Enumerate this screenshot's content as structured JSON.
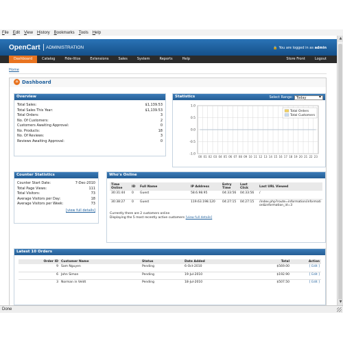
{
  "browser": {
    "menu": [
      "File",
      "Edit",
      "View",
      "History",
      "Bookmarks",
      "Tools",
      "Help"
    ],
    "status": "Done"
  },
  "header": {
    "logo": "OpenCart",
    "admin": "ADMINISTRATION",
    "logged_in_prefix": "You are logged in as",
    "user": "admin"
  },
  "nav": {
    "left": [
      "Dashboard",
      "Catalog",
      "Fide-Ittos",
      "Extensions",
      "Sales",
      "System",
      "Reports",
      "Help"
    ],
    "right": [
      "Store Front",
      "Logout"
    ]
  },
  "breadcrumb": "Home",
  "page_title": "Dashboard",
  "overview": {
    "title": "Overview",
    "rows": [
      {
        "label": "Total Sales:",
        "value": "$1,139.53"
      },
      {
        "label": "Total Sales This Year:",
        "value": "$1,139.53"
      },
      {
        "label": "Total Orders:",
        "value": "3"
      },
      {
        "label": "No. Of Customers:",
        "value": "2"
      },
      {
        "label": "Customers Awaiting Approval:",
        "value": "0"
      },
      {
        "label": "No. Products:",
        "value": "18"
      },
      {
        "label": "No. Of Reviews:",
        "value": "3"
      },
      {
        "label": "Reviews Awaiting Approval:",
        "value": "0"
      }
    ]
  },
  "statistics": {
    "title": "Statistics",
    "select_label": "Select Range:",
    "select_value": "Today"
  },
  "chart_data": {
    "type": "line",
    "x": [
      "00",
      "01",
      "02",
      "03",
      "04",
      "05",
      "06",
      "07",
      "08",
      "09",
      "10",
      "11",
      "12",
      "13",
      "14",
      "15",
      "16",
      "17",
      "18",
      "19",
      "20",
      "21",
      "22",
      "23"
    ],
    "series": [
      {
        "name": "Total Orders",
        "values": [
          0,
          0,
          0,
          0,
          0,
          0,
          0,
          0,
          0,
          0,
          0,
          0,
          0,
          0,
          0,
          0,
          0,
          0,
          0,
          0,
          0,
          0,
          0,
          0
        ]
      },
      {
        "name": "Total Customers",
        "values": [
          0,
          0,
          0,
          0,
          0,
          0,
          0,
          0,
          0,
          0,
          0,
          0,
          0,
          0,
          0,
          0,
          0,
          0,
          0,
          0,
          0,
          0,
          0,
          0
        ]
      }
    ],
    "yticks": [
      "1.0",
      "0.5",
      "0.0",
      "-0.5",
      "-1.0"
    ],
    "ylim": [
      -1,
      1
    ],
    "grid": true,
    "legend": "top-right",
    "colors": [
      "#f0d060",
      "#c8dcf0"
    ]
  },
  "counter": {
    "title": "Counter Statistics",
    "rows": [
      {
        "label": "Counter Start Date:",
        "value": "7-Dec-2010"
      },
      {
        "label": "Total Page Views:",
        "value": "111"
      },
      {
        "label": "Total Visitors:",
        "value": "73"
      },
      {
        "label": "Average Visitors per Day:",
        "value": "18"
      },
      {
        "label": "Average Visitors per Week:",
        "value": "73"
      }
    ],
    "link": "[view full details]"
  },
  "online": {
    "title": "Who's Online",
    "columns": [
      "Time Online",
      "ID",
      "Full Name",
      "IP Address",
      "Entry Time",
      "Last Click",
      "Last URL Viewed"
    ],
    "rows": [
      [
        "30:31:44",
        "0",
        "Guest",
        "58.6.98.95",
        "04:33:56",
        "04:33:56",
        "/"
      ],
      [
        "30:38:27",
        "0",
        "Guest",
        "119.63.198.120",
        "04:27:15",
        "04:27:15",
        "/index.php?route=information/information&information_id=3"
      ]
    ],
    "footer1": "Currently there are 2 customers online",
    "footer2": "Displaying the 5 most recently active customers",
    "footer_link": "[view full details]"
  },
  "orders": {
    "title": "Latest 10 Orders",
    "columns": [
      "Order ID",
      "Customer Name",
      "Status",
      "Date Added",
      "Total",
      "Action"
    ],
    "rows": [
      [
        "9",
        "Sam Nguyen",
        "Pending",
        "6-Oct-2010",
        "$569.00",
        "[ Edit ]"
      ],
      [
        "6",
        "John Simon",
        "Pending",
        "19-Jul-2010",
        "$192.90",
        "[ Edit ]"
      ],
      [
        "3",
        "Norman in Veldt",
        "Pending",
        "18-Jul-2010",
        "$507.50",
        "[ Edit ]"
      ]
    ]
  }
}
